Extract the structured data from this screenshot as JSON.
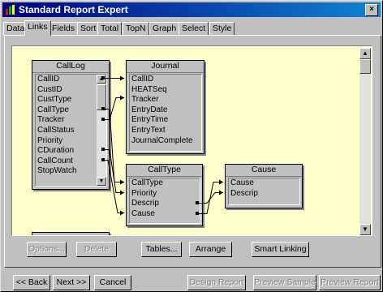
{
  "window": {
    "title": "Standard Report Expert",
    "close_label": "×"
  },
  "tabs": [
    {
      "label": "Data"
    },
    {
      "label": "Links"
    },
    {
      "label": "Fields"
    },
    {
      "label": "Sort"
    },
    {
      "label": "Total"
    },
    {
      "label": "TopN"
    },
    {
      "label": "Graph"
    },
    {
      "label": "Select"
    },
    {
      "label": "Style"
    }
  ],
  "active_tab": "Links",
  "tables": {
    "calllog": {
      "name": "CallLog",
      "fields": [
        "CallID",
        "CustID",
        "CustType",
        "CallType",
        "Tracker",
        "CallStatus",
        "Priority",
        "CDuration",
        "CallCount",
        "StopWatch"
      ]
    },
    "journal": {
      "name": "Journal",
      "fields": [
        "CallID",
        "HEATSeq",
        "Tracker",
        "EntryDate",
        "EntryTime",
        "EntryText",
        "JournalComplete"
      ]
    },
    "calltype": {
      "name": "CallType",
      "fields": [
        "CallType",
        "Priority",
        "Descrip",
        "Cause"
      ]
    },
    "cause": {
      "name": "Cause",
      "fields": [
        "Cause",
        "Descrip"
      ]
    }
  },
  "actions": {
    "options": "Options...",
    "delete": "Delete",
    "tables": "Tables...",
    "arrange": "Arrange",
    "smart_linking": "Smart Linking"
  },
  "nav": {
    "back": "<< Back",
    "next": "Next >>",
    "cancel": "Cancel",
    "design_report": "Design Report",
    "preview_sample": "Preview Sample",
    "preview_report": "Preview Report"
  },
  "colors": {
    "canvas": "#ffffcc",
    "titlebar": "#000080"
  }
}
